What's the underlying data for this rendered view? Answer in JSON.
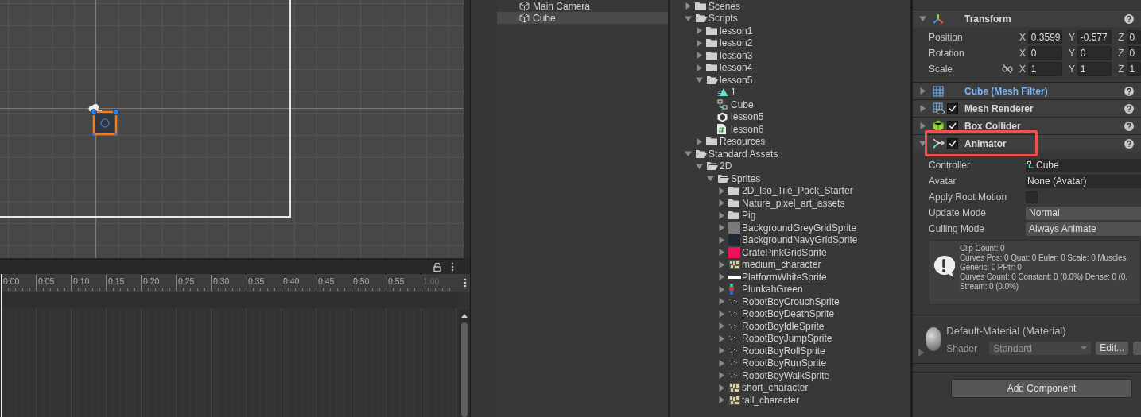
{
  "timeline": {
    "ticks": [
      "0:00",
      "0:05",
      "0:10",
      "0:15",
      "0:20",
      "0:25",
      "0:30",
      "0:35",
      "0:40",
      "0:45",
      "0:50",
      "0:55"
    ],
    "end_tick": "1:00"
  },
  "hierarchy": {
    "items": [
      {
        "name": "Main Camera",
        "selected": false
      },
      {
        "name": "Cube",
        "selected": true
      }
    ]
  },
  "project": {
    "tree": [
      {
        "name": "Scenes",
        "kind": "folder",
        "expanded": false
      },
      {
        "name": "Scripts",
        "kind": "folder",
        "expanded": true,
        "children": [
          {
            "name": "lesson1",
            "kind": "folder",
            "expanded": false
          },
          {
            "name": "lesson2",
            "kind": "folder",
            "expanded": false
          },
          {
            "name": "lesson3",
            "kind": "folder",
            "expanded": false
          },
          {
            "name": "lesson4",
            "kind": "folder",
            "expanded": false
          },
          {
            "name": "lesson5",
            "kind": "folder",
            "expanded": true,
            "children": [
              {
                "name": "1",
                "kind": "animation"
              },
              {
                "name": "Cube",
                "kind": "controller"
              },
              {
                "name": "lesson5",
                "kind": "scene"
              },
              {
                "name": "lesson6",
                "kind": "script"
              }
            ]
          },
          {
            "name": "Resources",
            "kind": "folder",
            "expanded": false
          }
        ]
      },
      {
        "name": "Standard Assets",
        "kind": "folder",
        "expanded": true,
        "children": [
          {
            "name": "2D",
            "kind": "folder",
            "expanded": true,
            "children": [
              {
                "name": "Sprites",
                "kind": "folder",
                "expanded": true,
                "children": [
                  {
                    "name": "2D_Iso_Tile_Pack_Starter",
                    "kind": "folder",
                    "expanded": false
                  },
                  {
                    "name": "Nature_pixel_art_assets",
                    "kind": "folder",
                    "expanded": false
                  },
                  {
                    "name": "Pig",
                    "kind": "folder",
                    "expanded": false
                  },
                  {
                    "name": "BackgroundGreyGridSprite",
                    "kind": "swatch",
                    "color": "#7a7a7a",
                    "expanded": false
                  },
                  {
                    "name": "BackgroundNavyGridSprite",
                    "kind": "swatch",
                    "color": "#1f2a38",
                    "expanded": false
                  },
                  {
                    "name": "CratePinkGridSprite",
                    "kind": "swatch",
                    "color": "#f0105a",
                    "expanded": false
                  },
                  {
                    "name": "medium_character",
                    "kind": "sheet",
                    "expanded": false
                  },
                  {
                    "name": "PlatformWhiteSprite",
                    "kind": "bar",
                    "expanded": false
                  },
                  {
                    "name": "PlunkahGreen",
                    "kind": "figure",
                    "expanded": false
                  },
                  {
                    "name": "RobotBoyCrouchSprite",
                    "kind": "dots",
                    "expanded": false
                  },
                  {
                    "name": "RobotBoyDeathSprite",
                    "kind": "dots",
                    "expanded": false
                  },
                  {
                    "name": "RobotBoyIdleSprite",
                    "kind": "dots",
                    "expanded": false
                  },
                  {
                    "name": "RobotBoyJumpSprite",
                    "kind": "dots",
                    "expanded": false
                  },
                  {
                    "name": "RobotBoyRollSprite",
                    "kind": "dots",
                    "expanded": false
                  },
                  {
                    "name": "RobotBoyRunSprite",
                    "kind": "dots",
                    "expanded": false
                  },
                  {
                    "name": "RobotBoyWalkSprite",
                    "kind": "dots",
                    "expanded": false
                  },
                  {
                    "name": "short_character",
                    "kind": "sheet",
                    "expanded": false
                  },
                  {
                    "name": "tall_character",
                    "kind": "sheet",
                    "expanded": false
                  }
                ]
              }
            ]
          }
        ]
      }
    ]
  },
  "inspector": {
    "components": [
      {
        "name": "Transform",
        "kind": "transform",
        "expanded": true,
        "rows": [
          {
            "label": "Position",
            "values": [
              {
                "axis": "X",
                "value": "0.3599"
              },
              {
                "axis": "Y",
                "value": "-0.577"
              },
              {
                "axis": "Z",
                "value": "0"
              }
            ]
          },
          {
            "label": "Rotation",
            "values": [
              {
                "axis": "X",
                "value": "0"
              },
              {
                "axis": "Y",
                "value": "0"
              },
              {
                "axis": "Z",
                "value": "0"
              }
            ]
          },
          {
            "label": "Scale",
            "constrained": false,
            "values": [
              {
                "axis": "X",
                "value": "1"
              },
              {
                "axis": "Y",
                "value": "1"
              },
              {
                "axis": "Z",
                "value": "1"
              }
            ]
          }
        ]
      },
      {
        "name": "Cube (Mesh Filter)",
        "kind": "meshfilter",
        "expanded": false,
        "overridden": true
      },
      {
        "name": "Mesh Renderer",
        "kind": "renderer",
        "expanded": false,
        "enabled": true
      },
      {
        "name": "Box Collider",
        "kind": "collider",
        "expanded": false,
        "enabled": true
      },
      {
        "name": "Animator",
        "kind": "animator",
        "expanded": true,
        "enabled": true,
        "highlighted": true,
        "fields": [
          {
            "label": "Controller",
            "kind": "object",
            "value": "Cube"
          },
          {
            "label": "Avatar",
            "kind": "object",
            "value": "None (Avatar)"
          },
          {
            "label": "Apply Root Motion",
            "kind": "toggle",
            "checked": false
          },
          {
            "label": "Update Mode",
            "kind": "dropdown",
            "value": "Normal"
          },
          {
            "label": "Culling Mode",
            "kind": "dropdown",
            "value": "Always Animate"
          }
        ],
        "info": [
          "Clip Count: 0",
          "Curves Pos: 0 Quat: 0 Euler: 0 Scale: 0 Muscles:",
          "Generic: 0 PPtr: 0",
          "Curves Count: 0 Constant: 0 (0.0%) Dense: 0 (0.",
          "Stream: 0 (0.0%)"
        ]
      }
    ],
    "material": {
      "name": "Default-Material (Material)",
      "shader_label": "Shader",
      "shader": "Standard",
      "edit_button": "Edit..."
    },
    "add_button": "Add Component"
  }
}
